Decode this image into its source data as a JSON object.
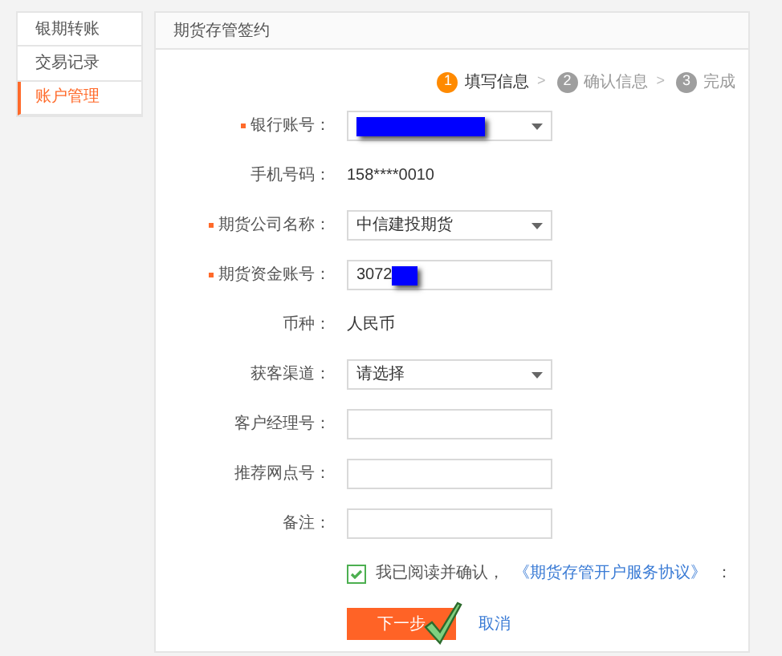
{
  "sidebar": {
    "items": [
      {
        "label": "银期转账",
        "selected": false
      },
      {
        "label": "交易记录",
        "selected": false
      },
      {
        "label": "账户管理",
        "selected": true
      }
    ]
  },
  "panel": {
    "title": "期货存管签约"
  },
  "steps": [
    {
      "number": "1",
      "label": "填写信息",
      "active": true
    },
    {
      "number": "2",
      "label": "确认信息",
      "active": false
    },
    {
      "number": "3",
      "label": "完成",
      "active": false
    }
  ],
  "step_separator": ">",
  "form": [
    {
      "kind": "select",
      "label": "银行账号：",
      "required": true,
      "redacted": true
    },
    {
      "kind": "text",
      "label": "手机号码：",
      "required": false,
      "value": "158****0010"
    },
    {
      "kind": "select",
      "label": "期货公司名称：",
      "required": true,
      "value": "中信建投期货"
    },
    {
      "kind": "input",
      "label": "期货资金账号：",
      "required": true,
      "value": "3072",
      "redacted": true
    },
    {
      "kind": "text",
      "label": "币种：",
      "required": false,
      "value": "人民币"
    },
    {
      "kind": "select",
      "label": "获客渠道：",
      "required": false,
      "value": "请选择"
    },
    {
      "kind": "input",
      "label": "客户经理号：",
      "required": false
    },
    {
      "kind": "input",
      "label": "推荐网点号：",
      "required": false
    },
    {
      "kind": "input",
      "label": "备注：",
      "required": false
    }
  ],
  "agreement": {
    "checked": true,
    "text": "我已阅读并确认，",
    "link": "《期货存管开户服务协议》",
    "suffix": "："
  },
  "buttons": {
    "next": "下一步",
    "cancel": "取消"
  }
}
